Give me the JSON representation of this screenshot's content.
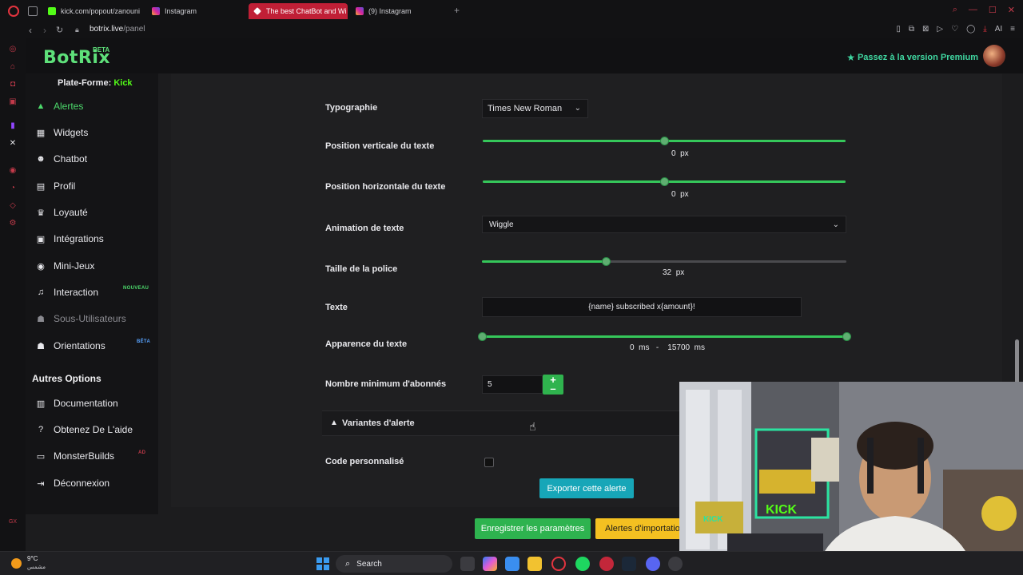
{
  "browser": {
    "tabs": [
      {
        "label": "kick.com/popout/zanouni",
        "active": false
      },
      {
        "label": "Instagram",
        "active": false
      },
      {
        "label": "The best ChatBot and Wi",
        "active": true
      },
      {
        "label": "(9) Instagram",
        "active": false
      }
    ],
    "url_domain": "botrix.live",
    "url_path": "/panel"
  },
  "header": {
    "brand": "BotRix",
    "brand_badge": "BETA",
    "premium_label": "Passez à la version Premium"
  },
  "sidebar": {
    "platform_prefix": "Plate-Forme:",
    "platform_name": "Kick",
    "items": [
      {
        "label": "Alertes",
        "icon": "warning-icon",
        "active": true
      },
      {
        "label": "Widgets",
        "icon": "widgets-icon"
      },
      {
        "label": "Chatbot",
        "icon": "robot-icon"
      },
      {
        "label": "Profil",
        "icon": "id-card-icon"
      },
      {
        "label": "Loyauté",
        "icon": "trophy-icon"
      },
      {
        "label": "Intégrations",
        "icon": "window-icon"
      },
      {
        "label": "Mini-Jeux",
        "icon": "gamepad-icon"
      },
      {
        "label": "Interaction",
        "icon": "music-note-icon",
        "badge": "NOUVEAU"
      },
      {
        "label": "Sous-Utilisateurs",
        "icon": "users-icon",
        "disabled": true
      },
      {
        "label": "Orientations",
        "icon": "users-icon",
        "badge": "BÊTA"
      }
    ],
    "other_title": "Autres Options",
    "other_items": [
      {
        "label": "Documentation",
        "icon": "book-icon"
      },
      {
        "label": "Obtenez De L'aide",
        "icon": "help-icon"
      },
      {
        "label": "MonsterBuilds",
        "icon": "laptop-icon",
        "badge": "AD"
      },
      {
        "label": "Déconnexion",
        "icon": "logout-icon"
      }
    ]
  },
  "form": {
    "typography": {
      "label": "Typographie",
      "value": "Times New Roman"
    },
    "vertical_pos": {
      "label": "Position verticale du texte",
      "value": "0",
      "unit": "px",
      "fraction": 0.5
    },
    "horizontal_pos": {
      "label": "Position horizontale du texte",
      "value": "0",
      "unit": "px",
      "fraction": 0.5
    },
    "animation": {
      "label": "Animation de texte",
      "value": "Wiggle"
    },
    "font_size": {
      "label": "Taille de la police",
      "value": "32",
      "unit": "px",
      "fraction": 0.34
    },
    "text": {
      "label": "Texte",
      "value": "{name} subscribed x{amount}!"
    },
    "appearance": {
      "label": "Apparence du texte",
      "min": "0",
      "max": "15700",
      "unit": "ms",
      "separator": "-",
      "fraction_start": 0.0,
      "fraction_end": 1.0
    },
    "min_subs": {
      "label": "Nombre minimum d'abonnés",
      "value": "5"
    },
    "variants_label": "Variantes d'alerte",
    "custom_code": {
      "label": "Code personnalisé",
      "checked": false
    }
  },
  "buttons": {
    "export": "Exporter cette alerte",
    "save": "Enregistrer les paramètres",
    "import": "Alertes d'importation"
  },
  "taskbar": {
    "temperature": "9°C",
    "weather_text": "مشمس",
    "search": "Search"
  },
  "colors": {
    "accent_green": "#35c75a",
    "brand_green": "#5ee07a",
    "export_blue": "#17a6b8",
    "import_yellow": "#f4c021"
  }
}
